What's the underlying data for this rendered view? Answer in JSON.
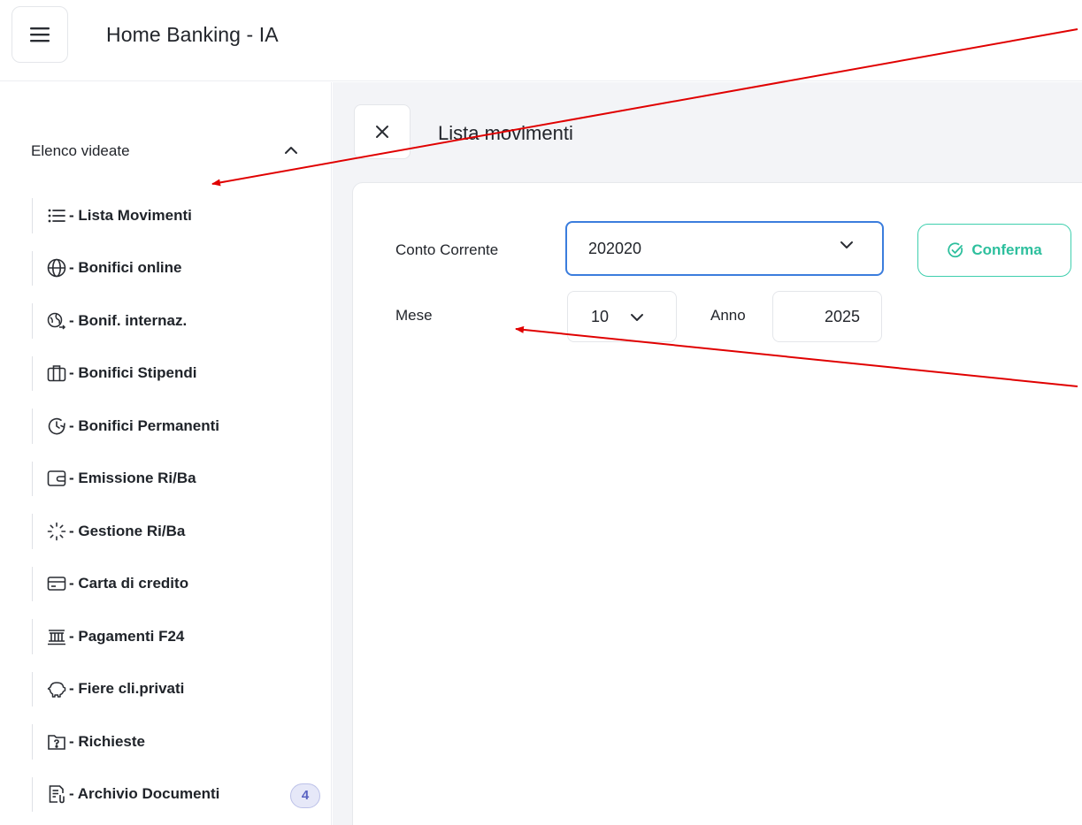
{
  "header": {
    "title": "Home Banking - IA",
    "menu_icon": "hamburger-icon"
  },
  "sidebar": {
    "section_title": "Elenco videate",
    "toggle_icon": "chevron-up-icon",
    "items": [
      {
        "label": "- Lista Movimenti",
        "icon": "list-icon"
      },
      {
        "label": "- Bonifici online",
        "icon": "globe-icon"
      },
      {
        "label": "- Bonif. internaz.",
        "icon": "international-transfer-icon"
      },
      {
        "label": "- Bonifici Stipendi",
        "icon": "briefcase-icon"
      },
      {
        "label": "- Bonifici Permanenti",
        "icon": "clock-refresh-icon"
      },
      {
        "label": "- Emissione Ri/Ba",
        "icon": "wallet-icon"
      },
      {
        "label": "- Gestione Ri/Ba",
        "icon": "loader-icon"
      },
      {
        "label": "- Carta di credito",
        "icon": "credit-card-icon"
      },
      {
        "label": "- Pagamenti F24",
        "icon": "bank-icon"
      },
      {
        "label": "- Fiere cli.privati",
        "icon": "piggy-bank-icon"
      },
      {
        "label": "- Richieste",
        "icon": "question-folder-icon"
      },
      {
        "label": "- Archivio Documenti",
        "icon": "document-attachment-icon",
        "badge": "4"
      }
    ]
  },
  "main": {
    "close_icon": "close-icon",
    "page_title": "Lista movimenti",
    "form": {
      "account_label": "Conto Corrente",
      "account_value": "202020",
      "confirm_label": "Conferma",
      "month_label": "Mese",
      "month_value": "10",
      "year_label": "Anno",
      "year_value": "2025"
    }
  },
  "colors": {
    "annotation_arrow": "#e00000",
    "focus_border": "#3b7ddd",
    "confirm_accent": "#2dbf9d",
    "badge_text": "#5a63c2"
  }
}
